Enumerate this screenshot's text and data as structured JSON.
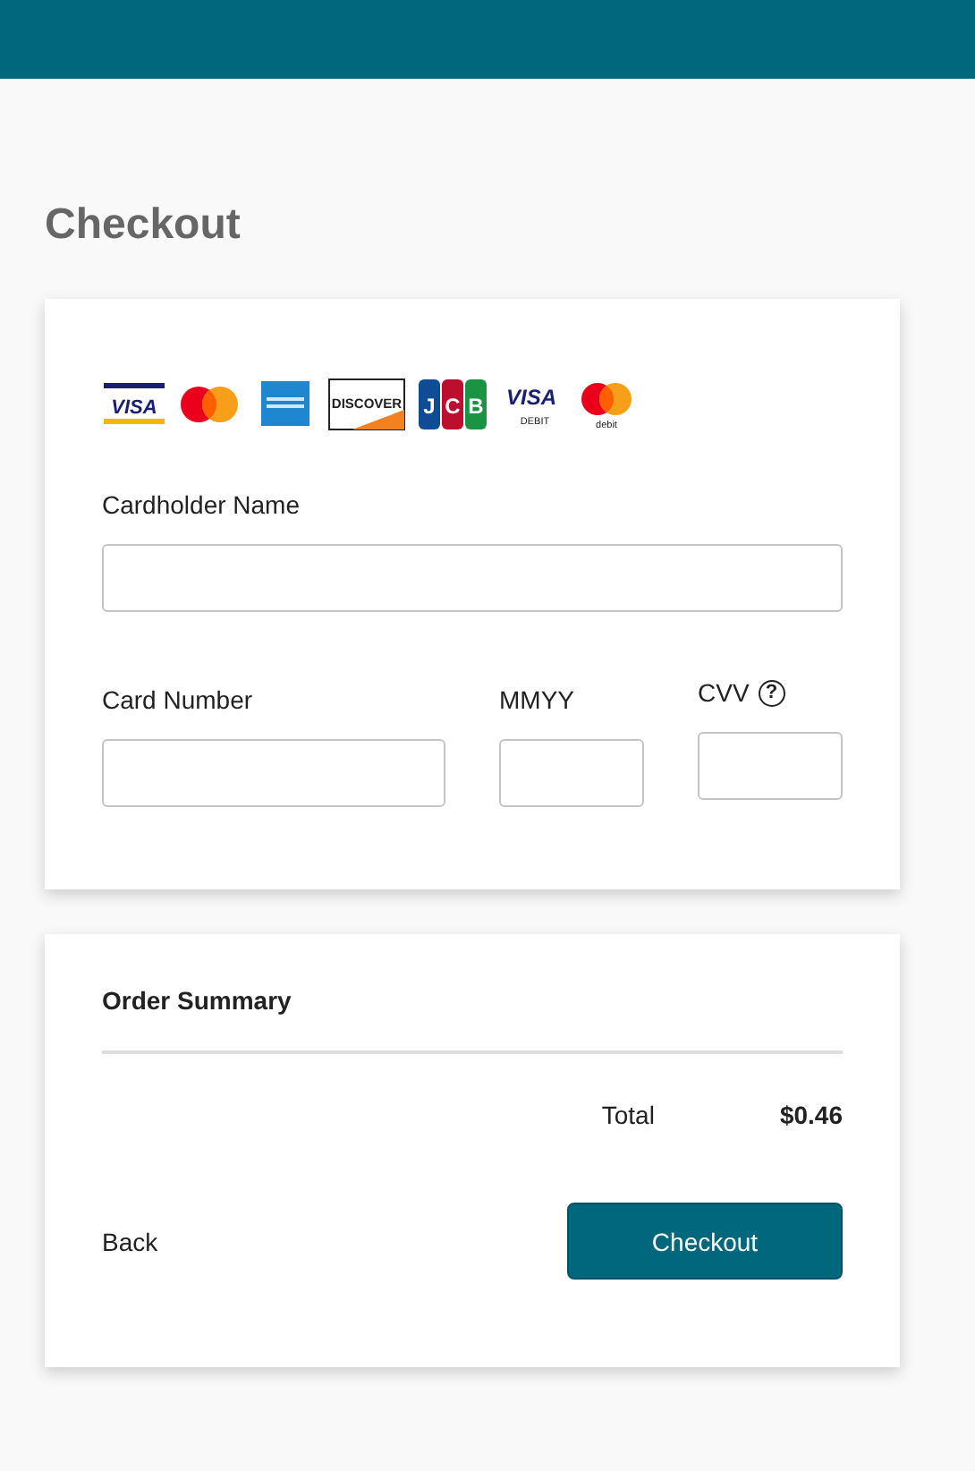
{
  "page_title": "Checkout",
  "card_logos": [
    {
      "kind": "visa",
      "text": "VISA"
    },
    {
      "kind": "mastercard"
    },
    {
      "kind": "amex"
    },
    {
      "kind": "discover",
      "text": "DISCOVER"
    },
    {
      "kind": "jcb",
      "letters": [
        "J",
        "C",
        "B"
      ]
    },
    {
      "kind": "visa-debit",
      "text": "VISA",
      "subtext": "DEBIT"
    },
    {
      "kind": "mastercard-debit",
      "subtext": "debit"
    }
  ],
  "cardholder_name": {
    "label": "Cardholder Name"
  },
  "card_number": {
    "label": "Card Number"
  },
  "expiry": {
    "label": "MMYY"
  },
  "cvv": {
    "label": "CVV",
    "help": "?"
  },
  "order_summary": {
    "title": "Order Summary",
    "total_label": "Total",
    "total_value": "$0.46"
  },
  "back_link": "Back",
  "checkout_button": "Checkout"
}
